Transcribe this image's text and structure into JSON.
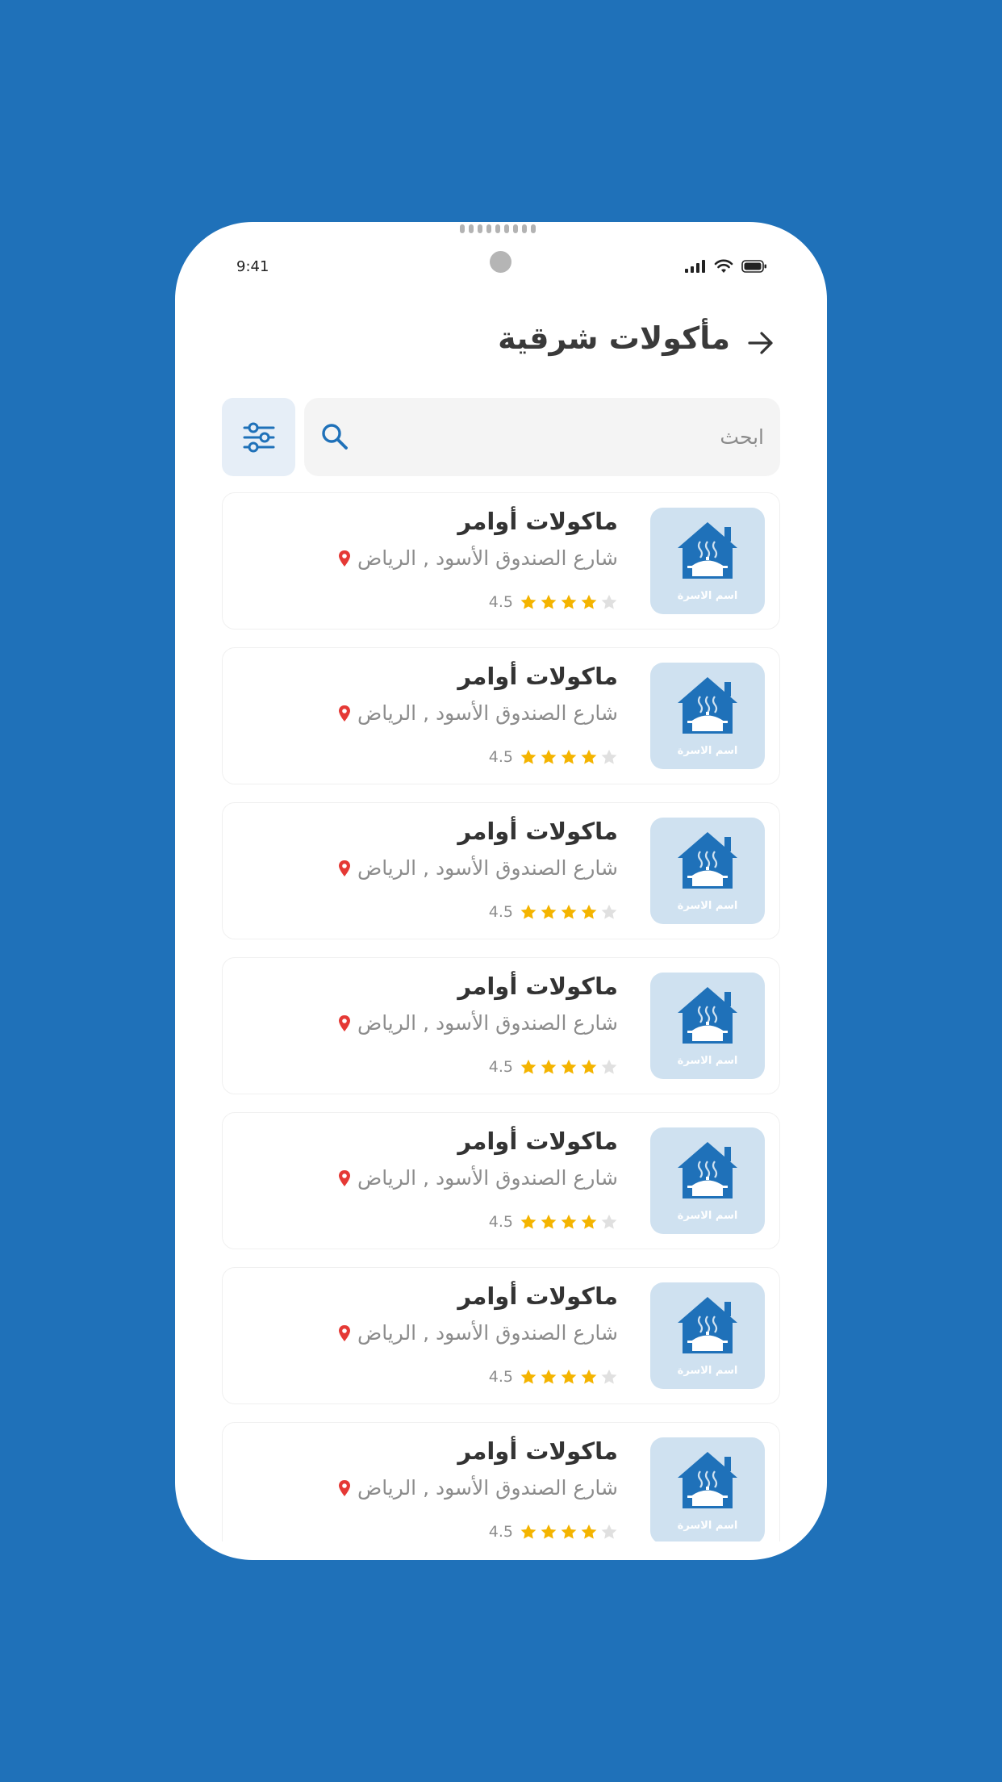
{
  "status_bar": {
    "time": "9:41",
    "icons": [
      "signal-icon",
      "wifi-icon",
      "battery-icon"
    ]
  },
  "header": {
    "title": "مأكولات شرقية",
    "back_icon": "arrow-right-icon"
  },
  "search": {
    "placeholder": "ابحث",
    "value": "",
    "icon": "search-icon",
    "filter_icon": "sliders-icon"
  },
  "colors": {
    "brand": "#1f71b9",
    "thumb_bg": "#cfe1f0",
    "star": "#f4b400",
    "star_empty": "#e0e0e0",
    "pin": "#e53935"
  },
  "listings": [
    {
      "name": "ماكولات أوامر",
      "address": "شارع الصندوق الأسود , الرياض",
      "rating": "4.5",
      "stars_filled": 4,
      "stars_total": 5,
      "thumb_label": "اسم الاسرة"
    },
    {
      "name": "ماكولات أوامر",
      "address": "شارع الصندوق الأسود , الرياض",
      "rating": "4.5",
      "stars_filled": 4,
      "stars_total": 5,
      "thumb_label": "اسم الاسرة"
    },
    {
      "name": "ماكولات أوامر",
      "address": "شارع الصندوق الأسود , الرياض",
      "rating": "4.5",
      "stars_filled": 4,
      "stars_total": 5,
      "thumb_label": "اسم الاسرة"
    },
    {
      "name": "ماكولات أوامر",
      "address": "شارع الصندوق الأسود , الرياض",
      "rating": "4.5",
      "stars_filled": 4,
      "stars_total": 5,
      "thumb_label": "اسم الاسرة"
    },
    {
      "name": "ماكولات أوامر",
      "address": "شارع الصندوق الأسود , الرياض",
      "rating": "4.5",
      "stars_filled": 4,
      "stars_total": 5,
      "thumb_label": "اسم الاسرة"
    },
    {
      "name": "ماكولات أوامر",
      "address": "شارع الصندوق الأسود , الرياض",
      "rating": "4.5",
      "stars_filled": 4,
      "stars_total": 5,
      "thumb_label": "اسم الاسرة"
    },
    {
      "name": "ماكولات أوامر",
      "address": "شارع الصندوق الأسود , الرياض",
      "rating": "4.5",
      "stars_filled": 4,
      "stars_total": 5,
      "thumb_label": "اسم الاسرة"
    }
  ]
}
